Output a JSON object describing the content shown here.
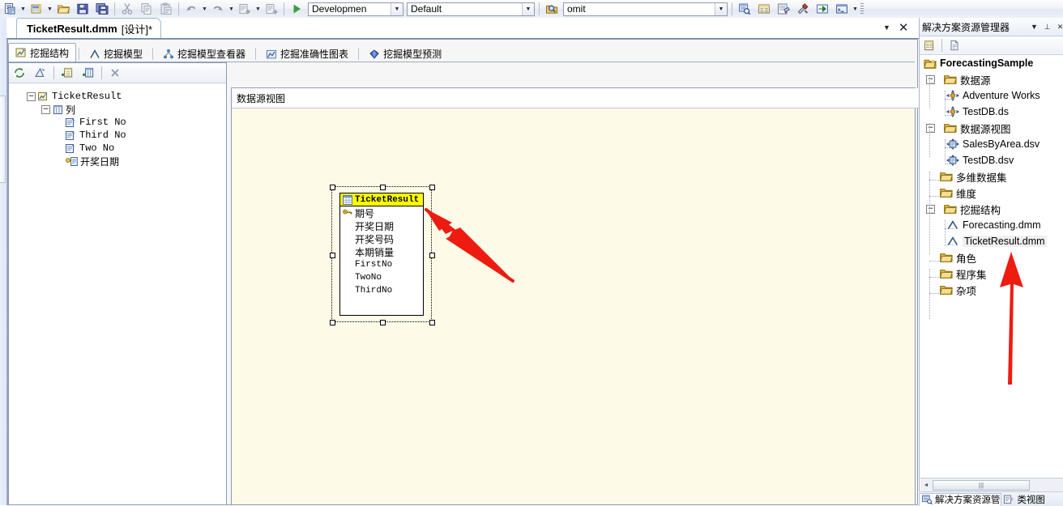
{
  "toolbar": {
    "buttons": [
      {
        "name": "new-item-icon",
        "label": "新建项"
      },
      {
        "name": "new-project-icon",
        "label": "新建项目"
      },
      {
        "name": "open-file-icon",
        "label": "打开文件"
      },
      {
        "name": "save-icon",
        "label": "保存"
      },
      {
        "name": "save-all-icon",
        "label": "全部保存"
      },
      {
        "name": "cut-icon",
        "label": "剪切"
      },
      {
        "name": "copy-icon",
        "label": "复制"
      },
      {
        "name": "paste-icon",
        "label": "粘贴"
      },
      {
        "name": "undo-icon",
        "label": "撤消"
      },
      {
        "name": "redo-icon",
        "label": "恢复"
      },
      {
        "name": "deploy-icon",
        "label": "部署"
      },
      {
        "name": "build-icon",
        "label": "生成"
      }
    ],
    "start_label": "▶",
    "config_combo": {
      "value": "Developmen",
      "placeholder": "Developmen"
    },
    "platform_combo": {
      "value": "Default",
      "placeholder": "Default"
    },
    "find_combo": {
      "value": "omit",
      "placeholder": "omit"
    },
    "right_buttons": [
      {
        "name": "solution-explorer-icon",
        "label": "解决方案资源管理器"
      },
      {
        "name": "properties-window-icon",
        "label": "属性窗口"
      },
      {
        "name": "object-browser-icon",
        "label": "对象浏览器"
      },
      {
        "name": "toolbox-icon",
        "label": "工具箱"
      },
      {
        "name": "output-window-icon",
        "label": "输出"
      },
      {
        "name": "command-window-icon",
        "label": "命令窗口"
      }
    ]
  },
  "document": {
    "tab_title": "TicketResult.dmm",
    "tab_suffix": "[设计]*",
    "dropdown_glyph": "▼",
    "close_glyph": "✕"
  },
  "designer_tabs": [
    {
      "label": "挖掘结构",
      "icon": "mining-structure-icon",
      "active": true
    },
    {
      "label": "挖掘模型",
      "icon": "mining-model-icon",
      "active": false
    },
    {
      "label": "挖掘模型查看器",
      "icon": "mining-viewer-icon",
      "active": false
    },
    {
      "label": "挖掘准确性图表",
      "icon": "accuracy-chart-icon",
      "active": false
    },
    {
      "label": "挖掘模型预测",
      "icon": "prediction-icon",
      "active": false
    }
  ],
  "structure_pane": {
    "toolbar_buttons": [
      {
        "name": "refresh-structure-icon",
        "label": "刷新"
      },
      {
        "name": "edit-structure-icon",
        "label": "编辑结构"
      },
      {
        "name": "add-table-icon",
        "label": "添加表"
      },
      {
        "name": "add-column-icon",
        "label": "添加列"
      },
      {
        "name": "delete-icon",
        "label": "删除"
      }
    ],
    "root": "TicketResult",
    "columns_node": "列",
    "columns": [
      "First No",
      "Third No",
      "Two No",
      "开奖日期"
    ]
  },
  "dsv_pane": {
    "title": "数据源视图",
    "entity": {
      "name": "TicketResult",
      "fields": [
        {
          "label": "期号",
          "key": true,
          "latin": false
        },
        {
          "label": "开奖日期",
          "key": false,
          "latin": false
        },
        {
          "label": "开奖号码",
          "key": false,
          "latin": false
        },
        {
          "label": "本期销量",
          "key": false,
          "latin": false
        },
        {
          "label": "FirstNo",
          "key": false,
          "latin": true
        },
        {
          "label": "TwoNo",
          "key": false,
          "latin": true
        },
        {
          "label": "ThirdNo",
          "key": false,
          "latin": true
        }
      ]
    }
  },
  "solution_explorer": {
    "title": "解决方案资源管理器",
    "dropdown_glyph": "▼",
    "pin_glyph": "⊥",
    "close_glyph": "✕",
    "toolbar_buttons": [
      {
        "name": "properties-icon",
        "label": "属性"
      },
      {
        "name": "show-all-files-icon",
        "label": "显示所有文件"
      }
    ],
    "project": "ForecastingSample",
    "nodes": [
      {
        "label": "数据源",
        "type": "folder",
        "indent": 1,
        "expander": "-",
        "children": [
          {
            "label": "Adventure Works",
            "type": "datasource",
            "indent": 2
          },
          {
            "label": "TestDB.ds",
            "type": "datasource",
            "indent": 2
          }
        ]
      },
      {
        "label": "数据源视图",
        "type": "folder",
        "indent": 1,
        "expander": "-",
        "children": [
          {
            "label": "SalesByArea.dsv",
            "type": "dsv",
            "indent": 2
          },
          {
            "label": "TestDB.dsv",
            "type": "dsv",
            "indent": 2
          }
        ]
      },
      {
        "label": "多维数据集",
        "type": "folder",
        "indent": 1,
        "expander": "",
        "children": []
      },
      {
        "label": "维度",
        "type": "folder",
        "indent": 1,
        "expander": "",
        "children": []
      },
      {
        "label": "挖掘结构",
        "type": "folder",
        "indent": 1,
        "expander": "-",
        "children": [
          {
            "label": "Forecasting.dmm",
            "type": "dmm",
            "indent": 2
          },
          {
            "label": "TicketResult.dmm",
            "type": "dmm",
            "indent": 2,
            "selected": true
          }
        ]
      },
      {
        "label": "角色",
        "type": "folder",
        "indent": 1,
        "expander": "",
        "children": []
      },
      {
        "label": "程序集",
        "type": "folder",
        "indent": 1,
        "expander": "",
        "children": []
      },
      {
        "label": "杂项",
        "type": "folder",
        "indent": 1,
        "expander": "",
        "children": []
      }
    ],
    "scrollbar": {
      "left_arrow": "◄",
      "thumb": "|||"
    },
    "bottom_tabs": [
      {
        "label": "解决方案资源管..",
        "icon": "solution-explorer-icon",
        "active": true
      },
      {
        "label": "类视图",
        "icon": "class-view-icon",
        "active": false
      }
    ]
  },
  "annotations": {
    "arrow_to_entity": {
      "name": "red-arrow-entity",
      "color": "#ee1b11"
    },
    "arrow_to_dmm": {
      "name": "red-arrow-dmm",
      "color": "#ee1b11"
    }
  }
}
